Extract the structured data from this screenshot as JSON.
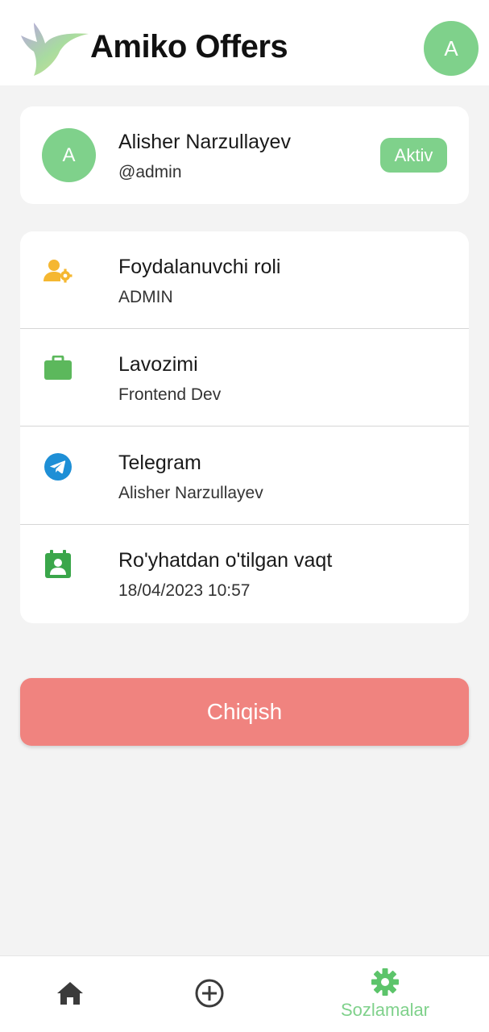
{
  "header": {
    "app_title": "Amiko Offers",
    "avatar_initial": "A"
  },
  "profile": {
    "avatar_initial": "A",
    "name": "Alisher Narzullayev",
    "username": "@admin",
    "status": "Aktiv"
  },
  "info": [
    {
      "icon": "user-gear-icon",
      "label": "Foydalanuvchi roli",
      "value": "ADMIN"
    },
    {
      "icon": "briefcase-icon",
      "label": "Lavozimi",
      "value": "Frontend Dev"
    },
    {
      "icon": "telegram-icon",
      "label": "Telegram",
      "value": "Alisher Narzullayev"
    },
    {
      "icon": "contact-calendar-icon",
      "label": "Ro'yhatdan o'tilgan vaqt",
      "value": "18/04/2023 10:57"
    }
  ],
  "logout_label": "Chiqish",
  "nav": {
    "home_icon": "home-icon",
    "add_icon": "add-circle-icon",
    "settings_label": "Sozlamalar",
    "active": "settings"
  },
  "colors": {
    "accent": "#7fd18b",
    "danger": "#f0837f",
    "role_icon": "#f5b731",
    "briefcase_icon": "#5cb85c",
    "telegram_icon": "#1e8fd6",
    "calendar_icon": "#3aa64a"
  }
}
